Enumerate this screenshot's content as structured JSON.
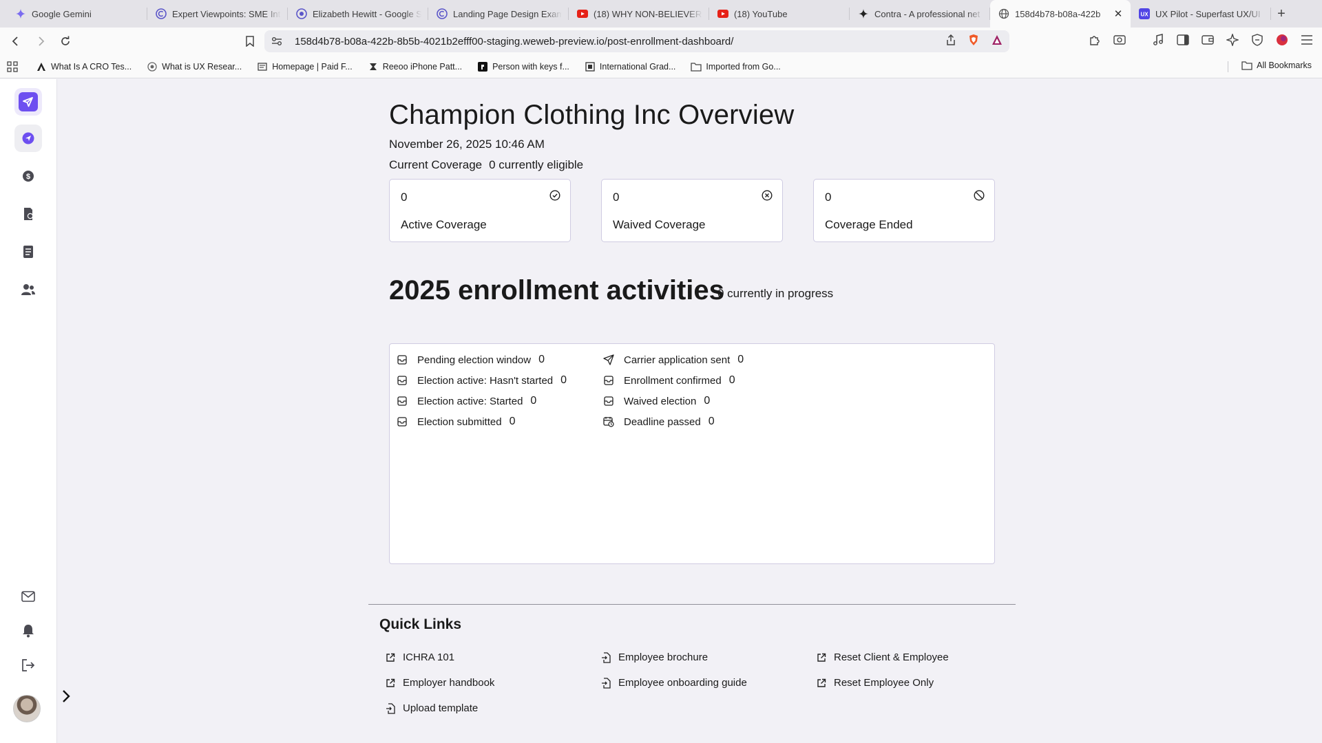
{
  "browser": {
    "tabs": [
      {
        "title": "Google Gemini",
        "icon": "gemini-icon",
        "active": false
      },
      {
        "title": "Expert Viewpoints: SME Int",
        "icon": "site-icon",
        "active": false
      },
      {
        "title": "Elizabeth Hewitt - Google S",
        "icon": "site-icon",
        "active": false
      },
      {
        "title": "Landing Page Design Exam",
        "icon": "site-icon",
        "active": false
      },
      {
        "title": "(18) WHY NON-BELIEVERS",
        "icon": "youtube-icon",
        "active": false
      },
      {
        "title": "(18) YouTube",
        "icon": "youtube-icon",
        "active": false
      },
      {
        "title": "Contra - A professional net",
        "icon": "contra-icon",
        "active": false
      },
      {
        "title": "158d4b78-b08a-422b",
        "icon": "globe-icon",
        "active": true
      },
      {
        "title": "UX Pilot - Superfast UX/UI",
        "icon": "uxpilot-icon",
        "active": false
      }
    ],
    "url": "158d4b78-b08a-422b-8b5b-4021b2efff00-staging.weweb-preview.io/post-enrollment-dashboard/",
    "bookmarks": [
      {
        "label": "What Is A CRO Tes...",
        "icon": "bookmark-site-icon"
      },
      {
        "label": "What is UX Resear...",
        "icon": "bookmark-site-icon"
      },
      {
        "label": "Homepage | Paid F...",
        "icon": "bookmark-site-icon"
      },
      {
        "label": "Reeoo iPhone Patt...",
        "icon": "bookmark-site-icon"
      },
      {
        "label": "Person with keys f...",
        "icon": "bookmark-site-icon"
      },
      {
        "label": "International Grad...",
        "icon": "bookmark-site-icon"
      },
      {
        "label": "Imported from Go...",
        "icon": "folder-icon"
      }
    ],
    "all_bookmarks": "All Bookmarks"
  },
  "colors": {
    "accent": "#6d4ff0",
    "card_border": "#cfcbe2",
    "page_bg": "#f2f1f6"
  },
  "page": {
    "title": "Champion Clothing Inc Overview",
    "datetime": "November 26, 2025 10:46 AM",
    "coverage_label": "Current Coverage",
    "coverage_eligible": "0 currently eligible"
  },
  "cards": [
    {
      "value": "0",
      "label": "Active Coverage",
      "icon": "check-circle-icon"
    },
    {
      "value": "0",
      "label": "Waived Coverage",
      "icon": "x-circle-icon"
    },
    {
      "value": "0",
      "label": "Coverage Ended",
      "icon": "ban-icon"
    }
  ],
  "activities": {
    "title": "2025 enrollment activities",
    "in_progress": "0 currently in progress",
    "left": [
      {
        "label": "Pending election window",
        "value": "0",
        "icon": "inbox-icon"
      },
      {
        "label": "Election active: Hasn't started",
        "value": "0",
        "icon": "inbox-icon"
      },
      {
        "label": "Election active: Started",
        "value": "0",
        "icon": "inbox-icon"
      },
      {
        "label": "Election submitted",
        "value": "0",
        "icon": "inbox-icon"
      }
    ],
    "right": [
      {
        "label": "Carrier application sent",
        "value": "0",
        "icon": "send-icon"
      },
      {
        "label": "Enrollment confirmed",
        "value": "0",
        "icon": "inbox-icon"
      },
      {
        "label": "Waived election",
        "value": "0",
        "icon": "inbox-icon"
      },
      {
        "label": "Deadline passed",
        "value": "0",
        "icon": "calendar-clock-icon"
      }
    ]
  },
  "quick_links": {
    "title": "Quick Links",
    "items": [
      {
        "label": "ICHRA 101",
        "icon": "external-link-icon"
      },
      {
        "label": "Employer handbook",
        "icon": "external-link-icon"
      },
      {
        "label": "Upload template",
        "icon": "file-import-icon"
      },
      {
        "label": "Employee brochure",
        "icon": "file-import-icon"
      },
      {
        "label": "Employee onboarding guide",
        "icon": "file-import-icon"
      },
      {
        "label": "Reset Client & Employee",
        "icon": "external-link-icon"
      },
      {
        "label": "Reset Employee Only",
        "icon": "external-link-icon"
      }
    ]
  }
}
